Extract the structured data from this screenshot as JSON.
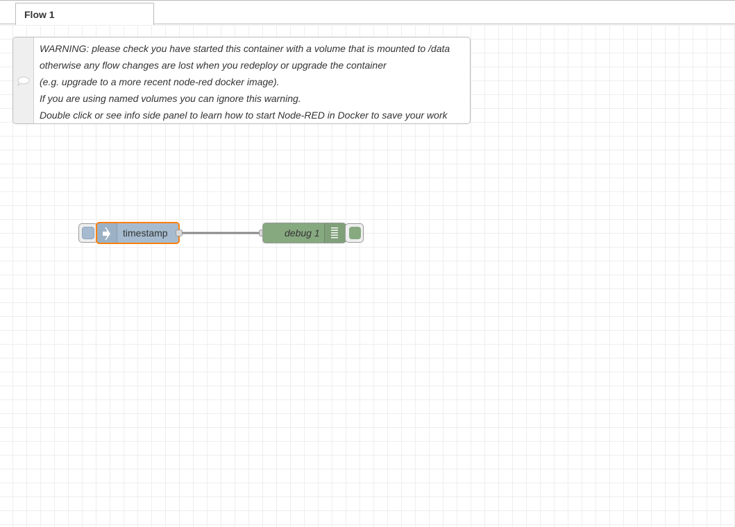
{
  "tabs": [
    {
      "label": "Flow 1",
      "active": true
    }
  ],
  "comment": {
    "icon": "comment-bubble-icon",
    "lines": [
      "WARNING: please check you have started this container with a volume that is mounted to /data",
      "otherwise any flow changes are lost when you redeploy or upgrade the container",
      "(e.g. upgrade to a more recent node-red docker image).",
      "If you are using named volumes you can ignore this warning.",
      "Double click or see info side panel to learn how to start Node-RED in Docker to save your work"
    ]
  },
  "nodes": {
    "inject": {
      "label": "timestamp",
      "icon": "inject-arrow-icon",
      "color": "#a6bbcf",
      "selected": true,
      "selection_color": "#ff7f0e"
    },
    "debug": {
      "label": "debug 1",
      "icon": "debug-list-icon",
      "color": "#87a980"
    }
  },
  "wires": [
    {
      "from": "timestamp",
      "to": "debug 1",
      "color": "#888888"
    }
  ],
  "colors": {
    "grid": "#eeeeee",
    "node_border": "#999999"
  }
}
